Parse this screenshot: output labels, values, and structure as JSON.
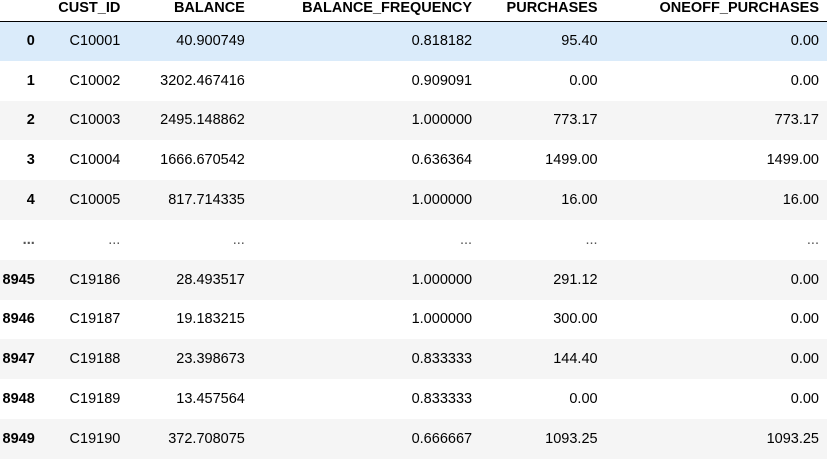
{
  "table": {
    "columns": [
      "",
      "CUST_ID",
      "BALANCE",
      "BALANCE_FREQUENCY",
      "PURCHASES",
      "ONEOFF_PURCHASES"
    ],
    "rows": [
      {
        "index": "0",
        "cust_id": "C10001",
        "balance": "40.900749",
        "balance_frequency": "0.818182",
        "purchases": "95.40",
        "oneoff_purchases": "0.00"
      },
      {
        "index": "1",
        "cust_id": "C10002",
        "balance": "3202.467416",
        "balance_frequency": "0.909091",
        "purchases": "0.00",
        "oneoff_purchases": "0.00"
      },
      {
        "index": "2",
        "cust_id": "C10003",
        "balance": "2495.148862",
        "balance_frequency": "1.000000",
        "purchases": "773.17",
        "oneoff_purchases": "773.17"
      },
      {
        "index": "3",
        "cust_id": "C10004",
        "balance": "1666.670542",
        "balance_frequency": "0.636364",
        "purchases": "1499.00",
        "oneoff_purchases": "1499.00"
      },
      {
        "index": "4",
        "cust_id": "C10005",
        "balance": "817.714335",
        "balance_frequency": "1.000000",
        "purchases": "16.00",
        "oneoff_purchases": "16.00"
      },
      {
        "index": "...",
        "cust_id": "...",
        "balance": "...",
        "balance_frequency": "...",
        "purchases": "...",
        "oneoff_purchases": "..."
      },
      {
        "index": "8945",
        "cust_id": "C19186",
        "balance": "28.493517",
        "balance_frequency": "1.000000",
        "purchases": "291.12",
        "oneoff_purchases": "0.00"
      },
      {
        "index": "8946",
        "cust_id": "C19187",
        "balance": "19.183215",
        "balance_frequency": "1.000000",
        "purchases": "300.00",
        "oneoff_purchases": "0.00"
      },
      {
        "index": "8947",
        "cust_id": "C19188",
        "balance": "23.398673",
        "balance_frequency": "0.833333",
        "purchases": "144.40",
        "oneoff_purchases": "0.00"
      },
      {
        "index": "8948",
        "cust_id": "C19189",
        "balance": "13.457564",
        "balance_frequency": "0.833333",
        "purchases": "0.00",
        "oneoff_purchases": "0.00"
      },
      {
        "index": "8949",
        "cust_id": "C19190",
        "balance": "372.708075",
        "balance_frequency": "0.666667",
        "purchases": "1093.25",
        "oneoff_purchases": "1093.25"
      }
    ]
  },
  "colors": {
    "header_border": "#000000",
    "row_odd": "#f5f5f5",
    "row_even": "#ffffff",
    "row_hover": "#daebfa"
  }
}
